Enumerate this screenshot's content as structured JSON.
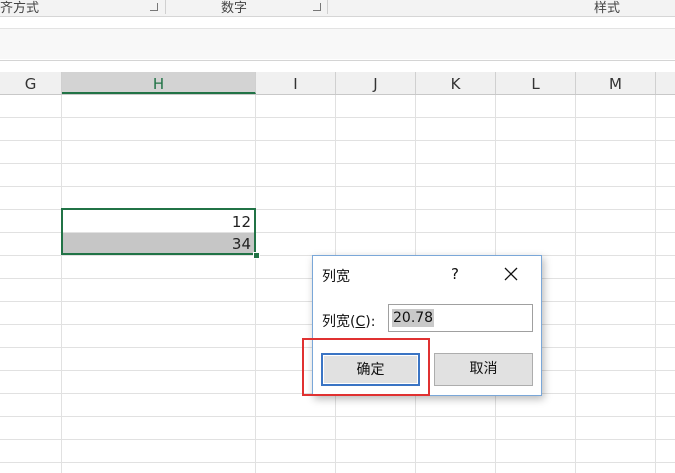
{
  "ribbon": {
    "groups": [
      {
        "label": "齐方式"
      },
      {
        "label": "数字"
      },
      {
        "label": "样式"
      }
    ]
  },
  "columns": [
    {
      "label": "G",
      "selected": false
    },
    {
      "label": "H",
      "selected": true
    },
    {
      "label": "I",
      "selected": false
    },
    {
      "label": "J",
      "selected": false
    },
    {
      "label": "K",
      "selected": false
    },
    {
      "label": "L",
      "selected": false
    },
    {
      "label": "M",
      "selected": false
    }
  ],
  "cells": [
    {
      "value": "12"
    },
    {
      "value": "34"
    }
  ],
  "dialog": {
    "title": "列宽",
    "help_label": "?",
    "field_label_prefix": "列宽(",
    "field_label_key": "C",
    "field_label_suffix": "):",
    "value": "20.78",
    "ok_label": "确定",
    "cancel_label": "取消"
  },
  "icons": {
    "close": "close-icon",
    "dialog_launcher": "dialog-launcher-icon"
  },
  "colors": {
    "selection": "#217346",
    "dialog_border": "#7aa7d8",
    "ok_button_border": "#3a74c4",
    "annotation_red": "#e03131",
    "highlight_fill": "#c6c6c6"
  }
}
